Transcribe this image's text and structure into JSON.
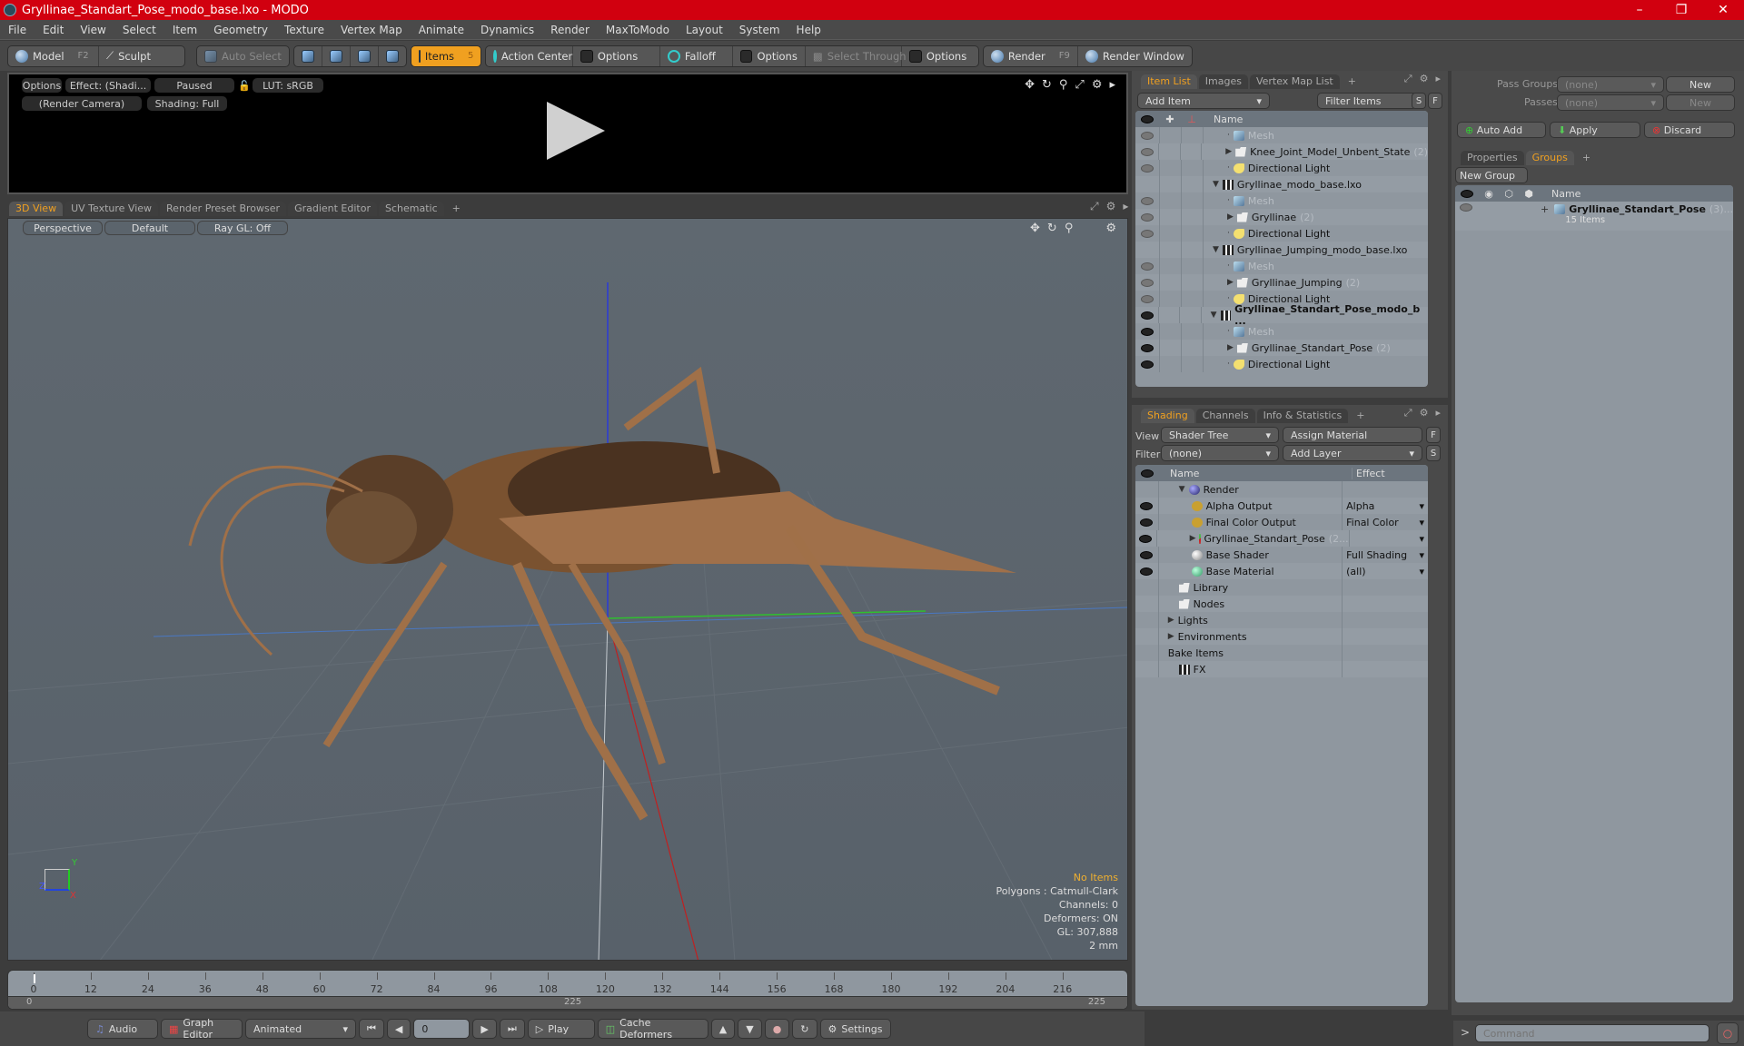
{
  "window": {
    "title": "Gryllinae_Standart_Pose_modo_base.lxo - MODO",
    "controls": [
      "minimize",
      "restore",
      "close"
    ]
  },
  "menu": [
    "File",
    "Edit",
    "View",
    "Select",
    "Item",
    "Geometry",
    "Texture",
    "Vertex Map",
    "Animate",
    "Dynamics",
    "Render",
    "MaxToModo",
    "Layout",
    "System",
    "Help"
  ],
  "toolbar": {
    "model": "Model",
    "model_key": "F2",
    "sculpt": "Sculpt",
    "auto_select": "Auto Select",
    "items": "Items",
    "items_key": "5",
    "action_center": "Action Center",
    "options1": "Options",
    "falloff": "Falloff",
    "options2": "Options",
    "select_through": "Select Through",
    "options3": "Options",
    "render": "Render",
    "render_key": "F9",
    "render_window": "Render Window"
  },
  "render_preview": {
    "options": "Options",
    "effect": "Effect: (Shadi...",
    "paused": "Paused",
    "lut": "LUT: sRGB",
    "camera": "(Render Camera)",
    "shading": "Shading: Full"
  },
  "viewport_tabs": [
    "3D View",
    "UV Texture View",
    "Render Preset Browser",
    "Gradient Editor",
    "Schematic",
    "+"
  ],
  "viewport": {
    "perspective": "Perspective",
    "default": "Default",
    "raygl": "Ray GL: Off",
    "stats": {
      "selection": "No Items",
      "polygons": "Polygons : Catmull-Clark",
      "channels": "Channels: 0",
      "deformers": "Deformers: ON",
      "gl": "GL: 307,888",
      "scale": "2 mm"
    },
    "axis_labels": {
      "x": "X",
      "y": "Y",
      "z": "Z"
    }
  },
  "item_list": {
    "tabs": [
      "Item List",
      "Images",
      "Vertex Map List",
      "+"
    ],
    "add_item": "Add Item",
    "filter_items": "Filter Items",
    "s": "S",
    "f": "F",
    "header_name": "Name",
    "rows": [
      {
        "name": "Mesh",
        "indent": 2,
        "icon": "mesh",
        "dim": true,
        "eye": "dim"
      },
      {
        "name": "Knee_Joint_Model_Unbent_State",
        "count": "(2)",
        "indent": 2,
        "icon": "folder",
        "expand": true,
        "eye": "dim"
      },
      {
        "name": "Directional Light",
        "indent": 2,
        "icon": "light",
        "eye": "dim"
      },
      {
        "name": "Gryllinae_modo_base.lxo",
        "indent": 1,
        "icon": "scene",
        "open": true,
        "eye": "none"
      },
      {
        "name": "Mesh",
        "indent": 2,
        "icon": "mesh",
        "dim": true,
        "eye": "dim"
      },
      {
        "name": "Gryllinae",
        "count": "(2)",
        "indent": 2,
        "icon": "folder",
        "expand": true,
        "eye": "dim"
      },
      {
        "name": "Directional Light",
        "indent": 2,
        "icon": "light",
        "eye": "dim"
      },
      {
        "name": "Gryllinae_Jumping_modo_base.lxo",
        "indent": 1,
        "icon": "scene",
        "open": true,
        "eye": "none"
      },
      {
        "name": "Mesh",
        "indent": 2,
        "icon": "mesh",
        "dim": true,
        "eye": "dim"
      },
      {
        "name": "Gryllinae_Jumping",
        "count": "(2)",
        "indent": 2,
        "icon": "folder",
        "expand": true,
        "eye": "dim"
      },
      {
        "name": "Directional Light",
        "indent": 2,
        "icon": "light",
        "eye": "dim"
      },
      {
        "name": "Gryllinae_Standart_Pose_modo_b ...",
        "indent": 1,
        "icon": "scene",
        "open": true,
        "bold": true,
        "eye": "on"
      },
      {
        "name": "Mesh",
        "indent": 2,
        "icon": "mesh",
        "dim": true,
        "eye": "on"
      },
      {
        "name": "Gryllinae_Standart_Pose",
        "count": "(2)",
        "indent": 2,
        "icon": "folder",
        "expand": true,
        "eye": "on"
      },
      {
        "name": "Directional Light",
        "indent": 2,
        "icon": "light",
        "eye": "on"
      }
    ]
  },
  "shading": {
    "tabs": [
      "Shading",
      "Channels",
      "Info & Statistics",
      "+"
    ],
    "view_label": "View",
    "view_value": "Shader Tree",
    "assign_material": "Assign Material",
    "f": "F",
    "filter_label": "Filter",
    "filter_value": "(none)",
    "add_layer": "Add Layer",
    "s": "S",
    "header_name": "Name",
    "header_effect": "Effect",
    "rows": [
      {
        "name": "Render",
        "effect": "",
        "indent": 1,
        "icon": "render",
        "open": true,
        "eye": false
      },
      {
        "name": "Alpha Output",
        "effect": "Alpha",
        "indent": 2,
        "icon": "output",
        "eye": true,
        "dropdown": true
      },
      {
        "name": "Final Color Output",
        "effect": "Final Color",
        "indent": 2,
        "icon": "output",
        "eye": true,
        "dropdown": true
      },
      {
        "name": "Gryllinae_Standart_Pose",
        "count": "(2...",
        "effect": "",
        "indent": 2,
        "icon": "material-mask",
        "expand": true,
        "eye": true,
        "dropdown": true
      },
      {
        "name": "Base Shader",
        "effect": "Full Shading",
        "indent": 2,
        "icon": "shader",
        "eye": true,
        "dropdown": true
      },
      {
        "name": "Base Material",
        "effect": "(all)",
        "indent": 2,
        "icon": "material",
        "eye": true,
        "dropdown": true
      },
      {
        "name": "Library",
        "effect": "",
        "indent": 1,
        "icon": "folder",
        "eye": false
      },
      {
        "name": "Nodes",
        "effect": "",
        "indent": 1,
        "icon": "folder",
        "eye": false
      },
      {
        "name": "Lights",
        "effect": "",
        "indent": 0,
        "expand": true,
        "eye": false
      },
      {
        "name": "Environments",
        "effect": "",
        "indent": 0,
        "expand": true,
        "eye": false
      },
      {
        "name": "Bake Items",
        "effect": "",
        "indent": 0,
        "eye": false
      },
      {
        "name": "FX",
        "effect": "",
        "indent": 1,
        "icon": "scene",
        "eye": false
      }
    ]
  },
  "passes": {
    "pass_groups_label": "Pass Groups",
    "pass_groups_value": "(none)",
    "new1": "New",
    "passes_label": "Passes",
    "passes_value": "(none)",
    "new2": "New",
    "auto_add": "Auto Add",
    "apply": "Apply",
    "discard": "Discard"
  },
  "groups": {
    "tabs": [
      "Properties",
      "Groups",
      "+"
    ],
    "new_group": "New Group",
    "header_name": "Name",
    "group_name": "Gryllinae_Standart_Pose",
    "group_count": "(3)...",
    "group_items": "15 Items"
  },
  "timeline": {
    "ticks": [
      0,
      12,
      24,
      36,
      48,
      60,
      72,
      84,
      96,
      108,
      120,
      132,
      144,
      156,
      168,
      180,
      192,
      204,
      216
    ],
    "start": "0",
    "end": "225",
    "end_top": "225",
    "current": 0
  },
  "bottom": {
    "audio": "Audio",
    "graph_editor": "Graph Editor",
    "animated": "Animated",
    "frame": "0",
    "play": "Play",
    "cache_deformers": "Cache Deformers",
    "settings": "Settings"
  },
  "command": {
    "placeholder": "Command",
    "prompt": ">"
  },
  "colors": {
    "title_bar": "#d1000f",
    "accent": "#f0a020",
    "panel_list": "#8f979f"
  }
}
